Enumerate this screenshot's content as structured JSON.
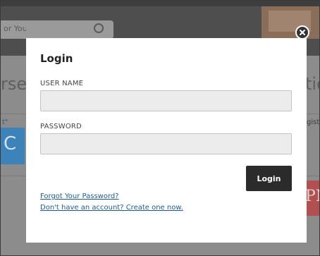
{
  "background": {
    "search_fragment": "or You",
    "word_left_fragment": "rse",
    "word_right_fragment": "tio",
    "link_left_fragment": "t\"",
    "link_right_fragment": "gist",
    "blue_tile_fragment": "C",
    "red_tile_fragment": "PM",
    "colors": {
      "header": "#4e4e4e",
      "body": "#8c8c8c",
      "blue_tile": "#3d82b8",
      "red_tile": "#b05050"
    }
  },
  "modal": {
    "title": "Login",
    "close_icon": "close-icon",
    "username": {
      "label": "USER NAME",
      "value": "",
      "placeholder": ""
    },
    "password": {
      "label": "PASSWORD",
      "value": "",
      "placeholder": ""
    },
    "login_label": "Login",
    "forgot_password_link": "Forgot Your Password?",
    "create_account_link": "Don't have an account? Create one now.",
    "colors": {
      "button": "#2b2b2b",
      "link": "#1f5a8c",
      "input_bg": "#ececec"
    }
  }
}
